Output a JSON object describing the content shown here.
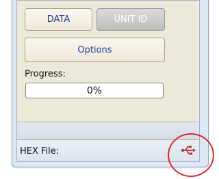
{
  "buttons": {
    "data_label": "DATA",
    "unit_id_label": "UNIT ID",
    "options_label": "Options"
  },
  "progress": {
    "label": "Progress:",
    "value": 0,
    "text": "0%"
  },
  "status_bar": {
    "hex_file_label": "HEX File:",
    "connection_icon": "usb-icon"
  },
  "colors": {
    "button_text": "#1b3d9a",
    "highlight": "#e0262b",
    "usb_icon": "#c0332c"
  }
}
